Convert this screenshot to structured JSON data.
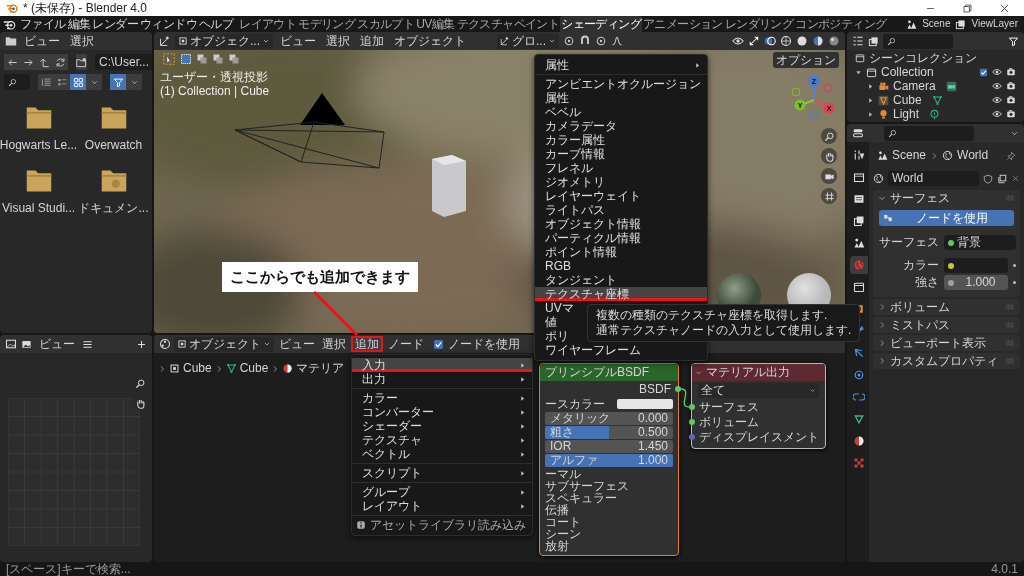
{
  "window": {
    "title": "* (未保存) - Blender 4.0"
  },
  "menu_bar": [
    "ファイル",
    "編集",
    "レンダー",
    "ウィンドウ",
    "ヘルプ"
  ],
  "workspaces": [
    {
      "label": "レイアウト",
      "selected": false
    },
    {
      "label": "モデリング",
      "selected": false
    },
    {
      "label": "スカルプト",
      "selected": false
    },
    {
      "label": "UV編集",
      "selected": false
    },
    {
      "label": "テクスチャペイント",
      "selected": false
    },
    {
      "label": "シェーディング",
      "selected": true
    },
    {
      "label": "アニメーション",
      "selected": false
    },
    {
      "label": "レンダリング",
      "selected": false
    },
    {
      "label": "コンポジティング",
      "selected": false
    }
  ],
  "scene": "Scene",
  "view_layer": "ViewLayer",
  "file_browser": {
    "menus": [
      "ビュー",
      "選択"
    ],
    "path": "C:\\User...",
    "items": [
      {
        "label": "Hogwarts Le...",
        "kind": "folder"
      },
      {
        "label": "Overwatch",
        "kind": "folder"
      },
      {
        "label": "Visual Studi...",
        "kind": "folder"
      },
      {
        "label": "ドキュメン...",
        "kind": "documents"
      }
    ]
  },
  "viewport": {
    "mode": "オブジェク...",
    "menus": [
      "ビュー",
      "選択",
      "追加",
      "オブジェクト"
    ],
    "orientation": "グロ...",
    "options": "オプション",
    "view_name": "ユーザー・透視投影",
    "context": "(1) Collection | Cube",
    "gizmo_axes": [
      "Z",
      "Y",
      "X"
    ]
  },
  "image_editor": {
    "menus": [
      "ビュー"
    ]
  },
  "node_editor": {
    "mode": "オブジェクト",
    "menus": [
      {
        "label": "ビュー",
        "marked": false
      },
      {
        "label": "選択",
        "marked": false
      },
      {
        "label": "追加",
        "marked": true
      },
      {
        "label": "ノード",
        "marked": false
      }
    ],
    "use_nodes": {
      "label": "ノードを使用",
      "checked": true
    },
    "breadcrumbs": [
      "Cube",
      "Cube",
      "マテリア"
    ],
    "principled": {
      "title": "プリンシプルBSDF",
      "output": "BSDF",
      "rows": [
        {
          "kind": "color",
          "label": "ースカラー"
        },
        {
          "kind": "slider",
          "label": "メタリック",
          "value": "0.000",
          "level": 0
        },
        {
          "kind": "slider",
          "label": "粗さ",
          "value": "0.500",
          "level": 0.5
        },
        {
          "kind": "number",
          "label": "IOR",
          "value": "1.450"
        },
        {
          "kind": "slider",
          "label": "アルファ",
          "value": "1.000",
          "level": 1
        },
        {
          "kind": "panel",
          "label": "ーマル"
        },
        {
          "kind": "panel",
          "label": "サブサーフェス"
        },
        {
          "kind": "panel",
          "label": "スペキュラー"
        },
        {
          "kind": "panel",
          "label": "伝播"
        },
        {
          "kind": "panel",
          "label": "コート"
        },
        {
          "kind": "panel",
          "label": "シーン"
        },
        {
          "kind": "panel",
          "label": "放射"
        }
      ]
    },
    "output": {
      "title": "マテリアル出力",
      "target": "全て",
      "sockets": [
        {
          "label": "サーフェス",
          "color": "#63c763"
        },
        {
          "label": "ボリューム",
          "color": "#63c763"
        },
        {
          "label": "ディスプレイスメント",
          "color": "#6363c7"
        }
      ]
    }
  },
  "add_menu": {
    "sections": [
      [
        {
          "label": "入力",
          "kind": "submenu",
          "selected": true,
          "marked": true
        },
        {
          "label": "出力",
          "kind": "submenu",
          "selected": false,
          "marked": false
        }
      ],
      [
        {
          "label": "カラー",
          "kind": "submenu",
          "selected": false,
          "marked": false
        },
        {
          "label": "コンバーター",
          "kind": "submenu",
          "selected": false,
          "marked": false
        },
        {
          "label": "シェーダー",
          "kind": "submenu",
          "selected": false,
          "marked": false
        },
        {
          "label": "テクスチャ",
          "kind": "submenu",
          "selected": false,
          "marked": false
        },
        {
          "label": "ベクトル",
          "kind": "submenu",
          "selected": false,
          "marked": false
        }
      ],
      [
        {
          "label": "スクリプト",
          "kind": "submenu",
          "selected": false,
          "marked": false
        }
      ],
      [
        {
          "label": "グループ",
          "kind": "submenu",
          "selected": false,
          "marked": false
        },
        {
          "label": "レイアウト",
          "kind": "submenu",
          "selected": false,
          "marked": false
        }
      ],
      [
        {
          "label": "アセットライブラリ読み込み",
          "kind": "info",
          "selected": false,
          "marked": false
        }
      ]
    ]
  },
  "input_menu": {
    "sections": [
      [
        {
          "label": "属性",
          "kind": "submenu",
          "selected": false,
          "marked": false
        }
      ],
      [
        {
          "label": "アンビエントオクルージョン",
          "kind": "item",
          "selected": false,
          "marked": false
        },
        {
          "label": "属性",
          "kind": "item",
          "selected": false,
          "marked": false
        },
        {
          "label": "ベベル",
          "kind": "item",
          "selected": false,
          "marked": false
        },
        {
          "label": "カメラデータ",
          "kind": "item",
          "selected": false,
          "marked": false
        },
        {
          "label": "カラー属性",
          "kind": "item",
          "selected": false,
          "marked": false
        },
        {
          "label": "カーブ情報",
          "kind": "item",
          "selected": false,
          "marked": false
        },
        {
          "label": "フレネル",
          "kind": "item",
          "selected": false,
          "marked": false
        },
        {
          "label": "ジオメトリ",
          "kind": "item",
          "selected": false,
          "marked": false
        },
        {
          "label": "レイヤーウェイト",
          "kind": "item",
          "selected": false,
          "marked": false
        },
        {
          "label": "ライトパス",
          "kind": "item",
          "selected": false,
          "marked": false
        },
        {
          "label": "オブジェクト情報",
          "kind": "item",
          "selected": false,
          "marked": false
        },
        {
          "label": "パーティクル情報",
          "kind": "item",
          "selected": false,
          "marked": false
        },
        {
          "label": "ポイント情報",
          "kind": "item",
          "selected": false,
          "marked": false
        },
        {
          "label": "RGB",
          "kind": "item",
          "selected": false,
          "marked": false
        },
        {
          "label": "タンジェント",
          "kind": "item",
          "selected": false,
          "marked": false
        },
        {
          "label": "テクスチャ座標",
          "kind": "item",
          "selected": true,
          "marked": true
        },
        {
          "label": "UVマ",
          "kind": "item",
          "selected": false,
          "marked": false
        },
        {
          "label": "値",
          "kind": "item",
          "selected": false,
          "marked": false
        },
        {
          "label": "ポリ",
          "kind": "item",
          "selected": false,
          "marked": false
        },
        {
          "label": "ワイヤーフレーム",
          "kind": "item",
          "selected": false,
          "marked": false
        }
      ]
    ]
  },
  "tooltip": [
    "複数の種類のテクスチャ座標を取得します.",
    "通常テクスチャノードの入力として使用します."
  ],
  "annotation": "ここからでも追加できます",
  "outliner": {
    "title": "シーンコレクション",
    "items": [
      {
        "label": "Collection",
        "kind": "collection",
        "checked": true,
        "expanded": true,
        "children": [
          {
            "label": "Camera",
            "kind": "camera",
            "expanded": false
          },
          {
            "label": "Cube",
            "kind": "mesh",
            "expanded": false
          },
          {
            "label": "Light",
            "kind": "light",
            "expanded": false
          }
        ]
      }
    ]
  },
  "properties": {
    "tabs": [
      {
        "kind": "tool",
        "selected": false
      },
      {
        "kind": "render",
        "selected": false
      },
      {
        "kind": "output",
        "selected": false
      },
      {
        "kind": "view_layer",
        "selected": false
      },
      {
        "kind": "scene",
        "selected": false
      },
      {
        "kind": "world",
        "selected": true
      },
      {
        "kind": "collection",
        "selected": false
      },
      {
        "kind": "object",
        "selected": false
      },
      {
        "kind": "modifier",
        "selected": false
      },
      {
        "kind": "particles",
        "selected": false
      },
      {
        "kind": "physics",
        "selected": false
      },
      {
        "kind": "constraints",
        "selected": false
      },
      {
        "kind": "data",
        "selected": false
      },
      {
        "kind": "material",
        "selected": false
      },
      {
        "kind": "texture",
        "selected": false
      }
    ],
    "breadcrumbs": [
      "Scene",
      "World"
    ],
    "world": "World",
    "panels": [
      {
        "title": "サーフェス",
        "expanded": true,
        "button": "ノードを使用",
        "fields": [
          {
            "label": "サーフェス",
            "kind": "shader",
            "value": "背景",
            "color": "#63c763"
          },
          {
            "label": "カラー",
            "kind": "color",
            "color": "#c7c729"
          },
          {
            "label": "強さ",
            "kind": "number",
            "value": "1.000",
            "color": "#a1a1a1"
          }
        ]
      },
      {
        "title": "ボリューム",
        "expanded": false
      },
      {
        "title": "ミストパス",
        "expanded": false
      },
      {
        "title": "ビューポート表示",
        "expanded": false
      },
      {
        "title": "カスタムプロパティ",
        "expanded": false
      }
    ]
  },
  "status_bar": {
    "hint": "[スペース]キーで検索...",
    "version": "4.0.1"
  }
}
